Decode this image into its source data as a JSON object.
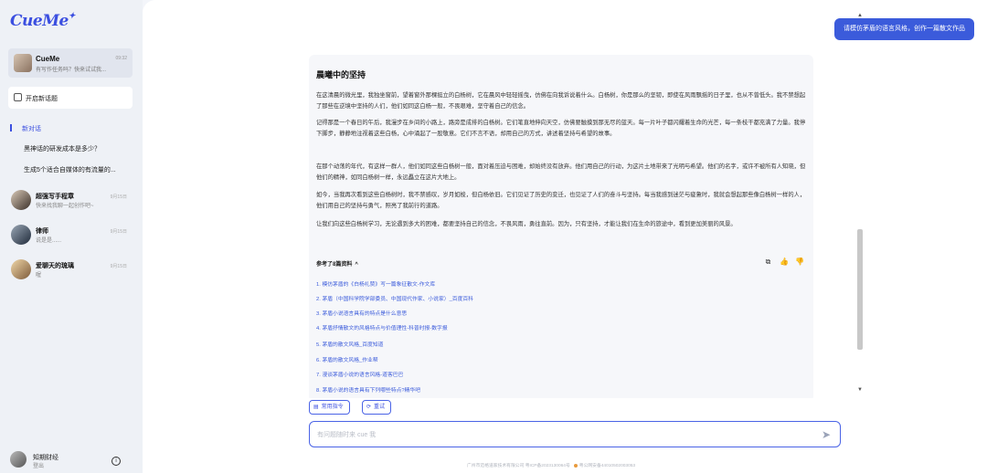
{
  "app": {
    "logo": "CueMe",
    "logo_star": "✦"
  },
  "sidebar": {
    "cueme": {
      "name": "CueMe",
      "sub": "有写作任务吗？快来试试我...",
      "time": "09:32"
    },
    "new_topic": "开启新话题",
    "group_label": "新对话",
    "conversations": [
      "黑神话的研发成本是多少？",
      "生成5个适合自媒体的有流量的..."
    ],
    "agents": [
      {
        "name": "超强写手程章",
        "desc": "快来找我聊一起创作吧~",
        "date": "9月15日"
      },
      {
        "name": "律师",
        "desc": "说是是......",
        "date": "9月15日"
      },
      {
        "name": "爱聊天的琉璃",
        "desc": "喔",
        "date": "9月15日"
      }
    ],
    "user": {
      "name": "知期财经",
      "sub": "登出"
    }
  },
  "chat": {
    "user_message": "请模仿茅盾的语言风格，创作一篇散文作品",
    "answer": {
      "title": "晨曦中的坚持",
      "paragraphs": [
        "在这清晨的微光里，我独坐窗前，望着窗外那棵挺立的白杨树，它在晨风中轻轻摇曳，仿佛在向我诉说着什么。白杨树，你是那么的坚韧，即使在风雨飘摇的日子里，也从不曾低头。我不禁想起了那些在逆境中坚持的人们，他们如同这白杨一般，不畏艰难，坚守着自己的信念。",
        "记得那是一个春日的午后，我漫步在乡间的小路上，路旁是成排的白杨树。它们笔直地伸向天空，仿佛要触摸到那无尽的蓝天。每一片叶子都闪耀着生命的光芒，每一条枝干都充满了力量。我停下脚步，静静地注视着这些白杨，心中涌起了一股敬意。它们不言不语，却用自己的方式，讲述着坚持与希望的故事。",
        "在那个动荡的年代，有这样一群人，他们如同这些白杨树一般，面对着压迫与困难，却始终没有放弃。他们用自己的行动，为这片土地带来了光明与希望。他们的名字，或许不被所有人知晓，但他们的精神，如同白杨树一样，永远矗立在这片大地上。",
        "如今，当我再次看到这些白杨树时，我不禁感叹，岁月如梭，但白杨依旧。它们见证了历史的变迁，也见证了人们的奋斗与坚持。每当我感到迷茫与疲惫时，我就会想起那些像白杨树一样的人，他们用自己的坚持与勇气，照亮了我前行的道路。",
        "让我们向这些白杨树学习，无论遇到多大的困难，都要坚持自己的信念，不畏风雨，勇往直前。因为，只有坚持，才能让我们在生命的旅途中，看到更加美丽的风景。"
      ],
      "refs_header": "参考了8篇资料",
      "refs": [
        "1. 模仿茅盾的《白杨礼赞》写一篇象征散文-作文库",
        "2. 茅盾（中国科学院学部委员、中国现代作家、小说家）_百度百科",
        "3. 茅盾小说语言具有的特点是什么意思",
        "4. 茅盾抒情散文的风格特点与价值理性-科普时报-数字报",
        "5. 茅盾的散文风格_百度知道",
        "6. 茅盾的散文风格_作业帮",
        "7. 漫谈茅盾小说的语言风格-道客巴巴",
        "8. 茅盾小说的语言具有下列哪些特点?精华吧"
      ]
    }
  },
  "actions": {
    "common": "常用指令",
    "retry": "重试"
  },
  "input": {
    "placeholder": "有问题随时来 cue 我"
  },
  "footer": {
    "icp": "广州市迈格道家技术有限公司 粤ICP备2023130064号",
    "police": "粤公网安备44010502003053"
  },
  "colors": {
    "accent": "#3b5bdb",
    "sidebar_bg": "#eef1f6"
  }
}
